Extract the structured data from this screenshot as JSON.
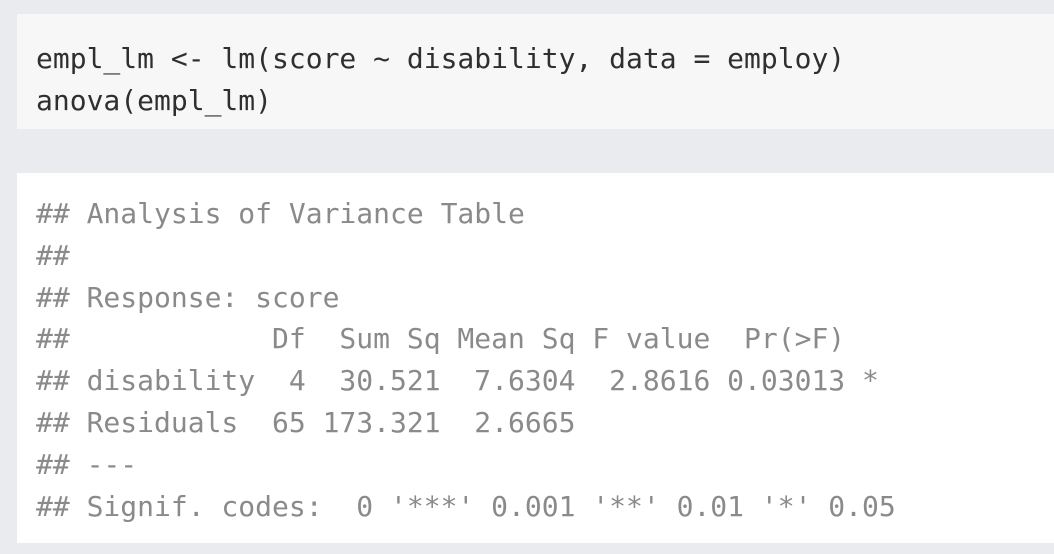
{
  "code": {
    "lines": [
      "empl_lm <- lm(score ~ disability, data = employ)",
      "anova(empl_lm)"
    ]
  },
  "output": {
    "lines": [
      "## Analysis of Variance Table",
      "##",
      "## Response: score",
      "##            Df  Sum Sq Mean Sq F value  Pr(>F)",
      "## disability  4  30.521  7.6304  2.8616 0.03013 *",
      "## Residuals  65 173.321  2.6665",
      "## ---",
      "## Signif. codes:  0 '***' 0.001 '**' 0.01 '*' 0.05"
    ]
  },
  "colors": {
    "page_background": "#e9ebee",
    "code_background": "#f7f7f7",
    "output_background": "#ffffff",
    "code_text": "#2f2f2f",
    "output_text": "#8a8a8a"
  }
}
